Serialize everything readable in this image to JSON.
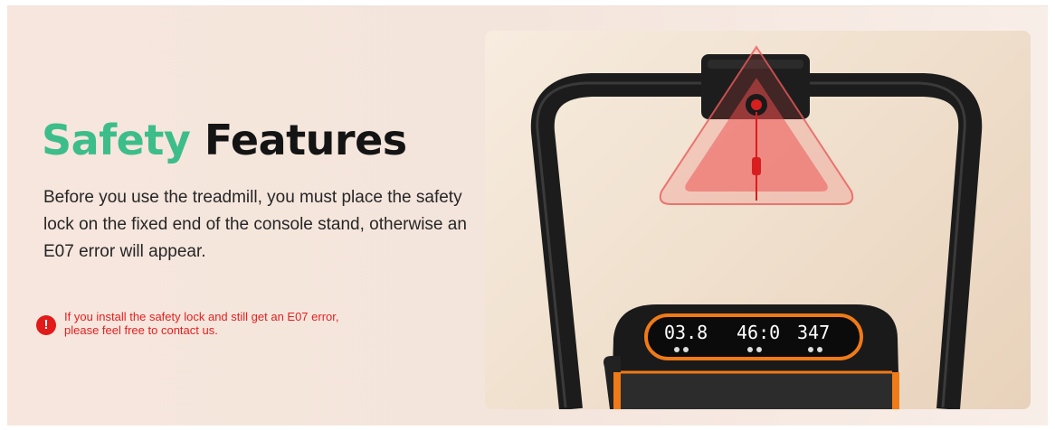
{
  "hero": {
    "title_accent": "Safety",
    "title_rest": "Features",
    "description": "Before you use the treadmill, you must place the safety lock on the fixed end of the console stand, otherwise an E07 error will appear.",
    "notice_icon": "exclamation-circle-icon",
    "notice_line1": "If you install the safety lock and still get an E07 error,",
    "notice_line2": "please feel free to contact us."
  },
  "product_image": {
    "display_speed": "03.8",
    "display_time": "46:0",
    "display_calories": "347"
  },
  "colors": {
    "accent_green": "#3dbd8a",
    "warning_red": "#e11a1a",
    "display_orange": "#ef7a18"
  }
}
